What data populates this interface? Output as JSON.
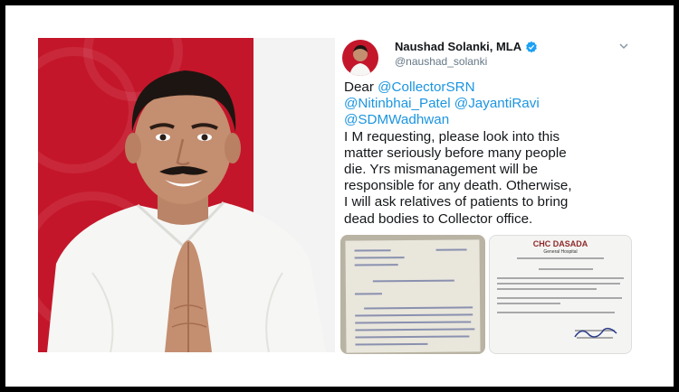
{
  "tweet": {
    "display_name": "Naushad Solanki, MLA",
    "handle": "@naushad_solanki",
    "text_lines": [
      [
        "Dear ",
        "@CollectorSRN"
      ],
      [
        "",
        "@Nitinbhai_Patel @JayantiRavi"
      ],
      [
        "",
        "@SDMWadhwan"
      ],
      [
        "I M requesting, please look into this",
        ""
      ],
      [
        "matter seriously before many people",
        ""
      ],
      [
        "die. Yrs mismanagement will be",
        ""
      ],
      [
        "responsible for any death. Otherwise,",
        ""
      ],
      [
        "I will ask relatives of patients to bring",
        ""
      ],
      [
        "dead bodies to Collector office.",
        ""
      ]
    ],
    "line1_plain": "Dear ",
    "line1_mention": "@CollectorSRN",
    "line2_mention": "@Nitinbhai_Patel @JayantiRavi",
    "line3_mention": "@SDMWadhwan",
    "line4": "I M requesting, please look into this",
    "line5": "matter seriously before many people",
    "line6": "die. Yrs mismanagement will be",
    "line7": "responsible for any death. Otherwise,",
    "line8": "I will ask relatives of patients to bring",
    "line9": "dead bodies to Collector office.",
    "mention_color": "#1b95e0"
  },
  "media": {
    "right_doc_title": "CHC DASADA",
    "right_doc_subtitle": "General Hospital"
  },
  "icons": {
    "verified": "verified-badge-icon",
    "menu": "chevron-down-icon"
  },
  "colors": {
    "backdrop_red": "#c4162a",
    "verified_blue": "#1da1f2"
  }
}
